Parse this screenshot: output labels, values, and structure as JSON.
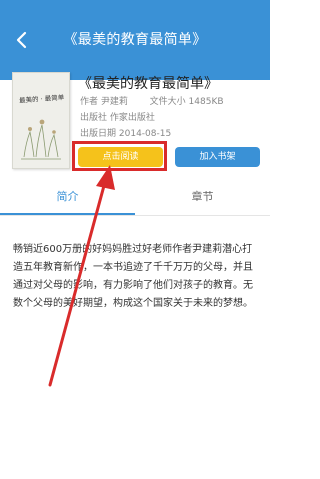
{
  "header": {
    "title": "《最美的教育最简单》"
  },
  "book": {
    "title": "《最美的教育最简单》",
    "author_label": "作者",
    "author": "尹建莉",
    "size_label": "文件大小",
    "size": "1485KB",
    "publisher_label": "出版社",
    "publisher": "作家出版社",
    "date_label": "出版日期",
    "date": "2014-08-15",
    "cover_text": "最美的 · 最简单"
  },
  "actions": {
    "read_label": "点击阅读",
    "shelf_label": "加入书架"
  },
  "tabs": [
    {
      "label": "简介",
      "active": true
    },
    {
      "label": "章节",
      "active": false
    }
  ],
  "intro": {
    "text": "畅销近600万册的好妈妈胜过好老师作者尹建莉潜心打造五年教育新作，一本书追迹了千千万万的父母，并且通过对父母的影响，有力影响了他们对孩子的教育。无数个父母的美好期望，构成这个国家关于未来的梦想。"
  },
  "colors": {
    "brand_blue": "#3a91d6",
    "read_yellow": "#f5c21b",
    "annotation_red": "#d92b2b"
  }
}
